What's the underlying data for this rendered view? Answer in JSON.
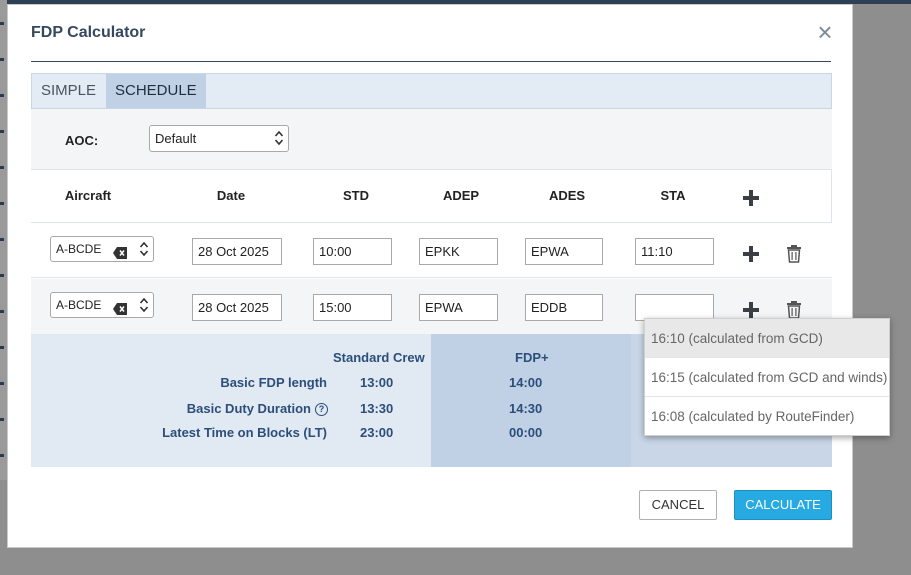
{
  "dialog": {
    "title": "FDP Calculator",
    "close_symbol": "×"
  },
  "tabs": [
    {
      "label": "SIMPLE",
      "active": false
    },
    {
      "label": "SCHEDULE",
      "active": true
    }
  ],
  "aoc": {
    "label": "AOC:",
    "value": "Default"
  },
  "table": {
    "headers": [
      "Aircraft",
      "Date",
      "STD",
      "ADEP",
      "ADES",
      "STA"
    ],
    "rows": [
      {
        "aircraft": "A-BCDE",
        "date": "28 Oct 2025",
        "std": "10:00",
        "adep": "EPKK",
        "ades": "EPWA",
        "sta": "11:10"
      },
      {
        "aircraft": "A-BCDE",
        "date": "28 Oct 2025",
        "std": "15:00",
        "adep": "EPWA",
        "ades": "EDDB",
        "sta": ""
      }
    ]
  },
  "summary": {
    "col_standard": "Standard Crew",
    "col_fdp_plus": "FDP+",
    "rows": [
      {
        "label": "Basic FDP length",
        "standard": "13:00",
        "fdp_plus": "14:00"
      },
      {
        "label": "Basic Duty Duration",
        "standard": "13:30",
        "fdp_plus": "14:30"
      },
      {
        "label": "Latest Time on Blocks  (LT)",
        "standard": "23:00",
        "fdp_plus": "00:00"
      }
    ],
    "help_symbol": "?"
  },
  "sta_dropdown": [
    "16:10 (calculated from GCD)",
    "16:15 (calculated from GCD and winds)",
    "16:08 (calculated by RouteFinder)"
  ],
  "buttons": {
    "cancel": "CANCEL",
    "calculate": "CALCULATE"
  },
  "icons": {
    "plus": "plus-icon",
    "trash": "trash-icon",
    "clear": "backspace-clear-icon",
    "updown": "select-updown-icon"
  },
  "colors": {
    "primary_button": "#27aae1",
    "title_text": "#34495e",
    "summary_text": "#2c4e7a",
    "tab_active_bg": "#c0d1e6"
  }
}
